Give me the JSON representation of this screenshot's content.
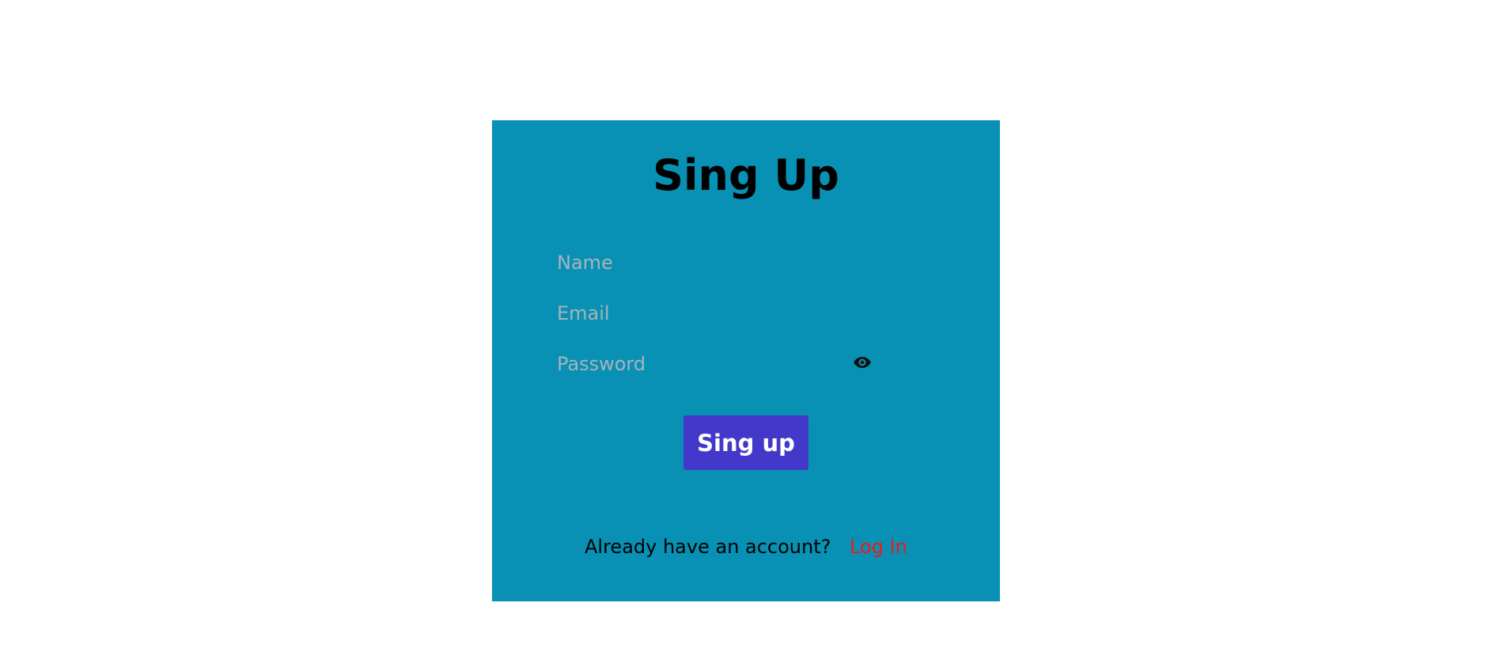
{
  "form": {
    "title": "Sing Up",
    "fields": {
      "name": {
        "placeholder": "Name",
        "value": ""
      },
      "email": {
        "placeholder": "Email",
        "value": ""
      },
      "password": {
        "placeholder": "Password",
        "value": "",
        "toggle_icon": "eye-icon"
      }
    },
    "submit_label": "Sing up",
    "footer": {
      "question": "Already have an account?",
      "login_label": "Log In"
    }
  },
  "colors": {
    "card_background": "#0891b4",
    "button_background": "#4338ca",
    "button_text": "#ffffff",
    "link": "#ef1a1a",
    "placeholder": "#a8b3bd"
  }
}
